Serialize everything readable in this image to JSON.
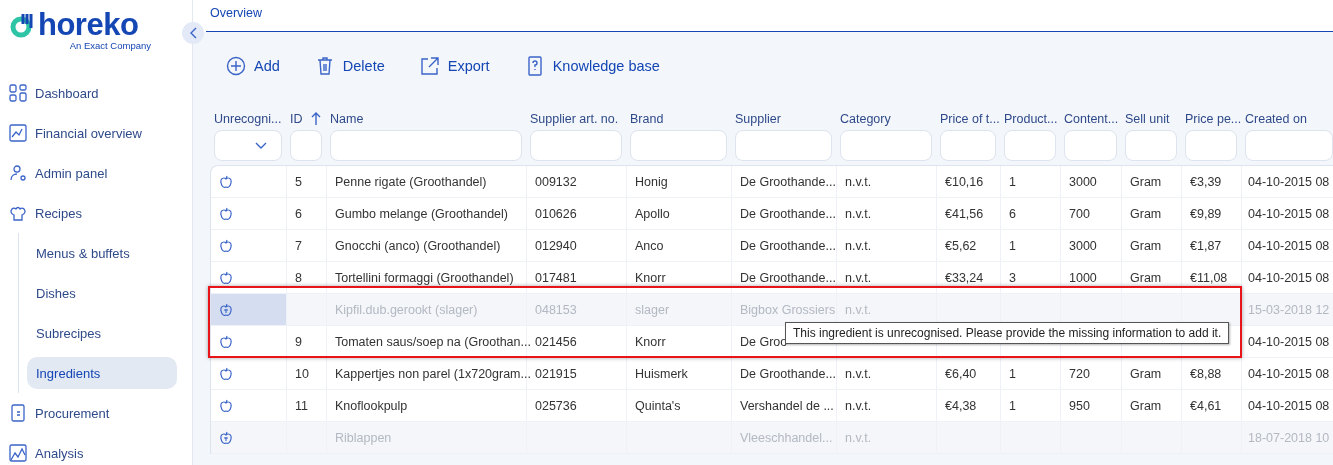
{
  "brand": {
    "name": "horeko",
    "tagline": "An Exact Company"
  },
  "sidebar": {
    "items": [
      {
        "label": "Dashboard",
        "selected": false
      },
      {
        "label": "Financial overview",
        "selected": false
      },
      {
        "label": "Admin panel",
        "selected": false
      },
      {
        "label": "Recipes",
        "selected": false,
        "expanded": true,
        "children": [
          {
            "label": "Menus & buffets",
            "selected": false
          },
          {
            "label": "Dishes",
            "selected": false
          },
          {
            "label": "Subrecipes",
            "selected": false
          },
          {
            "label": "Ingredients",
            "selected": true
          }
        ]
      },
      {
        "label": "Procurement",
        "selected": false
      },
      {
        "label": "Analysis",
        "selected": false
      }
    ]
  },
  "breadcrumb": "Overview",
  "toolbar": [
    "Add",
    "Delete",
    "Export",
    "Knowledge base"
  ],
  "table": {
    "columns": [
      {
        "label": "Unrecogni...",
        "kind": "dropdown",
        "sorted": false
      },
      {
        "label": "ID",
        "kind": "text",
        "sorted": true
      },
      {
        "label": "Name",
        "kind": "text",
        "sorted": false
      },
      {
        "label": "Supplier art. no.",
        "kind": "text",
        "sorted": false
      },
      {
        "label": "Brand",
        "kind": "text",
        "sorted": false
      },
      {
        "label": "Supplier",
        "kind": "text",
        "sorted": false
      },
      {
        "label": "Category",
        "kind": "text",
        "sorted": false
      },
      {
        "label": "Price of t...",
        "kind": "text",
        "sorted": false
      },
      {
        "label": "Product...",
        "kind": "text",
        "sorted": false
      },
      {
        "label": "Content...",
        "kind": "text",
        "sorted": false
      },
      {
        "label": "Sell unit",
        "kind": "text",
        "sorted": false
      },
      {
        "label": "Price pe...",
        "kind": "text",
        "sorted": false
      },
      {
        "label": "Created on",
        "kind": "text",
        "sorted": false
      }
    ],
    "rows": [
      {
        "kind": "recognised",
        "hovered": false,
        "cells": [
          null,
          "5",
          "Penne rigate (Groothandel)",
          "009132",
          "Honig",
          "De Groothande...",
          "n.v.t.",
          "€10,16",
          "1",
          "3000",
          "Gram",
          "€3,39",
          "04-10-2015 08"
        ]
      },
      {
        "kind": "recognised",
        "hovered": false,
        "cells": [
          null,
          "6",
          "Gumbo melange (Groothandel)",
          "010626",
          "Apollo",
          "De Groothande...",
          "n.v.t.",
          "€41,56",
          "6",
          "700",
          "Gram",
          "€9,89",
          "04-10-2015 08"
        ]
      },
      {
        "kind": "recognised",
        "hovered": false,
        "cells": [
          null,
          "7",
          "Gnocchi (anco) (Groothandel)",
          "012940",
          "Anco",
          "De Groothande...",
          "n.v.t.",
          "€5,62",
          "1",
          "3000",
          "Gram",
          "€1,87",
          "04-10-2015 08"
        ]
      },
      {
        "kind": "recognised",
        "hovered": false,
        "cells": [
          null,
          "8",
          "Tortellini formaggi (Groothandel)",
          "017481",
          "Knorr",
          "De Groothande...",
          "n.v.t.",
          "€33,24",
          "3",
          "1000",
          "Gram",
          "€11,08",
          "04-10-2015 08"
        ]
      },
      {
        "kind": "unrecognised",
        "hovered": true,
        "cells": [
          null,
          null,
          "Kipfil.dub.gerookt (slager)",
          "048153",
          "slager",
          "Bigbox Grossiers",
          "n.v.t.",
          null,
          null,
          null,
          null,
          null,
          "15-03-2018 12"
        ]
      },
      {
        "kind": "recognised",
        "hovered": false,
        "cells": [
          null,
          "9",
          "Tomaten saus/soep na (Groothan...",
          "021456",
          "Knorr",
          "De Groo",
          null,
          null,
          null,
          null,
          null,
          null,
          "04-10-2015 08"
        ]
      },
      {
        "kind": "recognised",
        "hovered": false,
        "cells": [
          null,
          "10",
          "Kappertjes non parel (1x720gram...",
          "021915",
          "Huismerk",
          "De Groothande...",
          "n.v.t.",
          "€6,40",
          "1",
          "720",
          "Gram",
          "€8,88",
          "04-10-2015 08"
        ]
      },
      {
        "kind": "recognised",
        "hovered": false,
        "cells": [
          null,
          "11",
          "Knoflookpulp",
          "025736",
          "Quinta's",
          "Vershandel de ...",
          "n.v.t.",
          "€4,38",
          "1",
          "950",
          "Gram",
          "€4,61",
          "04-10-2015 08"
        ]
      },
      {
        "kind": "unrecognised",
        "hovered": false,
        "cells": [
          null,
          null,
          "Riblappen",
          null,
          null,
          "Vleeschhandel...",
          "n.v.t.",
          null,
          null,
          null,
          null,
          null,
          "18-07-2018 10"
        ]
      }
    ]
  },
  "tooltip": "This ingredient is unrecognised. Please provide the missing information to add it."
}
